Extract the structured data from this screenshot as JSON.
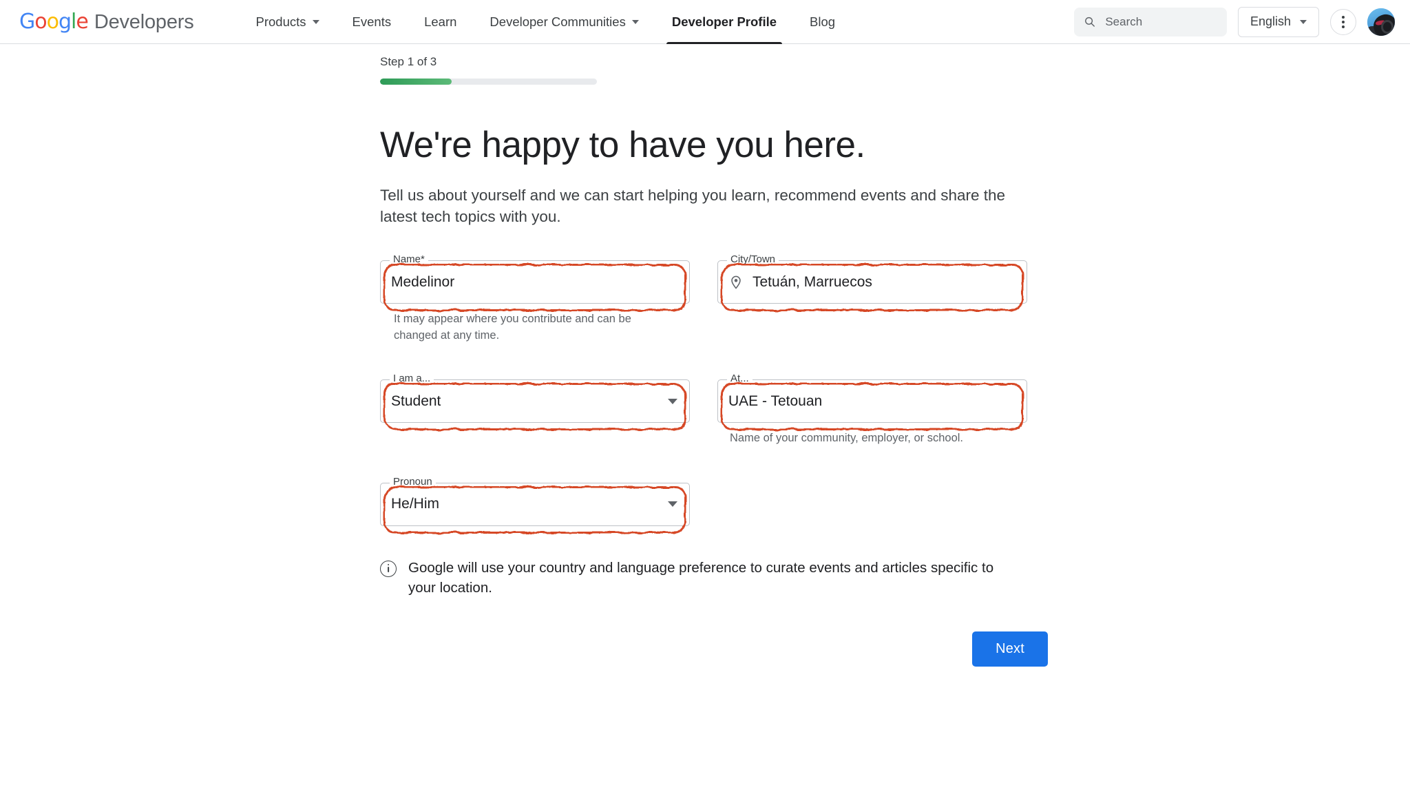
{
  "header": {
    "brand": {
      "google": "Google",
      "word": "Developers"
    },
    "nav": [
      {
        "label": "Products",
        "has_caret": true,
        "active": false
      },
      {
        "label": "Events",
        "has_caret": false,
        "active": false
      },
      {
        "label": "Learn",
        "has_caret": false,
        "active": false
      },
      {
        "label": "Developer Communities",
        "has_caret": true,
        "active": false
      },
      {
        "label": "Developer Profile",
        "has_caret": false,
        "active": true
      },
      {
        "label": "Blog",
        "has_caret": false,
        "active": false
      }
    ],
    "search": {
      "placeholder": "Search",
      "value": "",
      "icon": "search-icon"
    },
    "language": {
      "label": "English",
      "icon": "chevron-down-icon"
    },
    "overflow_icon": "kebab-menu-icon",
    "avatar_icon": "user-avatar"
  },
  "main": {
    "step_label": "Step 1 of 3",
    "progress": {
      "current": 1,
      "total": 3,
      "percent": 33,
      "fill_color": "#34a853",
      "track_color": "#e8eaed"
    },
    "title": "We're happy to have you here.",
    "lede": "Tell us about yourself and we can start helping you learn, recommend events and share the latest tech topics with you.",
    "fields": {
      "name": {
        "legend": "Name*",
        "value": "Medelinor",
        "helper": "It may appear where you contribute and can be changed at any time.",
        "annotated": true
      },
      "city": {
        "legend": "City/Town",
        "value": "Tetuán, Marruecos",
        "icon": "location-pin-icon",
        "helper": "",
        "annotated": true
      },
      "i_am_a": {
        "legend": "I am a...",
        "value": "Student",
        "type": "select",
        "helper": "",
        "annotated": true
      },
      "at": {
        "legend": "At...",
        "value": "UAE - Tetouan",
        "helper": "Name of your community, employer, or school.",
        "annotated": true
      },
      "pronoun": {
        "legend": "Pronoun",
        "value": "He/Him",
        "type": "select",
        "helper": "",
        "annotated": true
      }
    },
    "note": {
      "icon": "info-circle-icon",
      "text": "Google will use your country and language preference to curate events and articles specific to your location."
    },
    "next_button": {
      "label": "Next",
      "color": "#1a73e8"
    }
  }
}
